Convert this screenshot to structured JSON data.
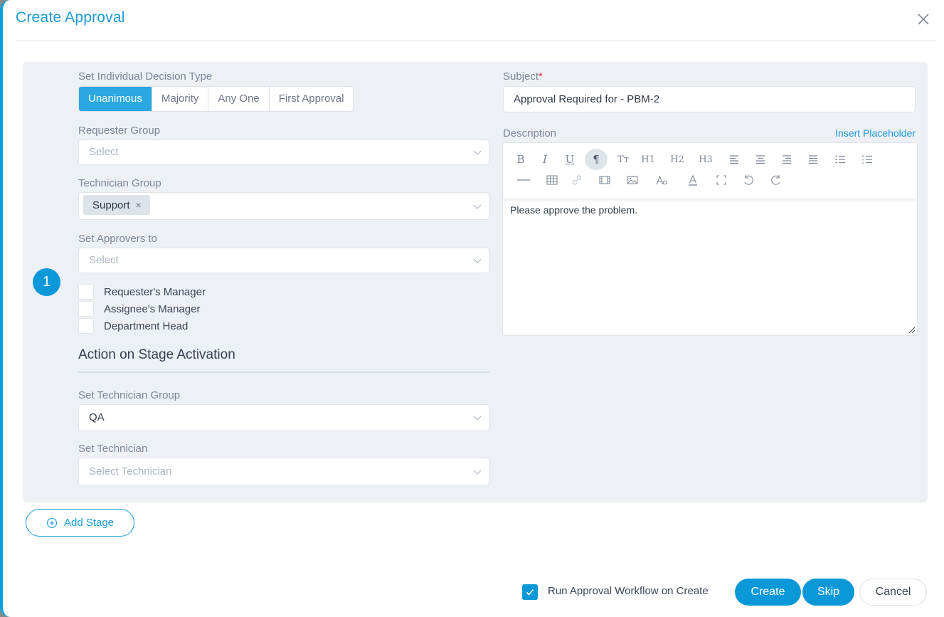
{
  "dialog": {
    "title": "Create Approval",
    "close_icon": "close-icon"
  },
  "stage": {
    "number": "1",
    "decision_type": {
      "label": "Set Individual Decision Type",
      "options": [
        "Unanimous",
        "Majority",
        "Any One",
        "First Approval"
      ],
      "selected": "Unanimous"
    },
    "requester_group": {
      "label": "Requester Group",
      "placeholder": "Select"
    },
    "technician_group": {
      "label": "Technician Group",
      "tags": [
        "Support"
      ],
      "tag_remove": "×"
    },
    "set_approvers_to": {
      "label": "Set Approvers to",
      "placeholder": "Select"
    },
    "approver_checkboxes": [
      {
        "label": "Requester's Manager",
        "checked": false
      },
      {
        "label": "Assignee's Manager",
        "checked": false
      },
      {
        "label": "Department Head",
        "checked": false
      }
    ],
    "action_section": {
      "title": "Action on Stage Activation",
      "set_technician_group": {
        "label": "Set Technician Group",
        "value": "QA"
      },
      "set_technician": {
        "label": "Set Technician",
        "placeholder": "Select Technician"
      }
    },
    "subject": {
      "label": "Subject",
      "required_mark": "*",
      "value": "Approval Required for - PBM-2"
    },
    "description": {
      "label": "Description",
      "insert_placeholder": "Insert Placeholder",
      "toolbar_row1": [
        "bold",
        "italic",
        "underline",
        "paragraph",
        "text-size",
        "heading-1",
        "heading-2",
        "heading-3",
        "align-left",
        "align-center",
        "align-right",
        "align-justify",
        "bullet-list",
        "numbered-list"
      ],
      "toolbar_row2": [
        "horizontal-rule",
        "table",
        "link",
        "video",
        "image",
        "font-style",
        "text-color",
        "fullscreen",
        "undo",
        "redo"
      ],
      "toolbar_text": {
        "bold": "B",
        "italic": "I",
        "underline": "U",
        "paragraph": "¶",
        "text_size": "Tт",
        "h1": "H1",
        "h2": "H2",
        "h3": "H3"
      },
      "active_tool": "paragraph",
      "content": "Please approve the problem."
    }
  },
  "add_stage": {
    "label": "Add Stage"
  },
  "footer": {
    "run_workflow": {
      "label": "Run Approval Workflow on Create",
      "checked": true
    },
    "create_label": "Create",
    "skip_label": "Skip",
    "cancel_label": "Cancel"
  },
  "colors": {
    "accent": "#0a98d8",
    "segment_active": "#2ba8e0",
    "stage_background": "#edf0f5",
    "required": "#e5333a"
  }
}
